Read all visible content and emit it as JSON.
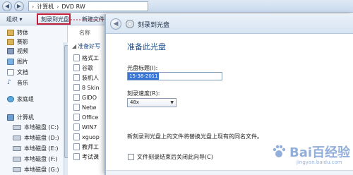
{
  "explorer": {
    "address": {
      "back_icon": "back-arrow-icon",
      "forward_icon": "forward-arrow-icon",
      "segments": [
        "计算机",
        "DVD RW"
      ]
    },
    "toolbar": {
      "organize_label": "组织 ▾",
      "burn_label": "刻录到光盘",
      "new_label": "新建文件夹"
    },
    "nav": {
      "libraries": [
        {
          "label": "视频",
          "icon": "video-library-icon"
        },
        {
          "label": "图片",
          "icon": "pictures-library-icon"
        },
        {
          "label": "文档",
          "icon": "documents-library-icon"
        },
        {
          "label": "音乐",
          "icon": "music-library-icon"
        }
      ],
      "top_items": [
        {
          "label": "转体",
          "icon": "library-icon"
        },
        {
          "label": "赛影",
          "icon": "library-icon"
        }
      ],
      "homegroup": "家庭组",
      "computer": "计算机",
      "drives": [
        "本地磁盘 (C:)",
        "本地磁盘 (D:)",
        "本地磁盘 (E:)",
        "本地磁盘 (F:)",
        "本地磁盘 (G:)"
      ]
    },
    "files": {
      "column_name": "名称",
      "group_heading": "准备好写",
      "items": [
        "格式工",
        "谷歌",
        "装机人",
        "8 Skin",
        "GIDO",
        "Netw",
        "Office",
        "WIN7",
        "xguop",
        "教师工",
        "考试课"
      ]
    }
  },
  "dialog": {
    "title": "刻录到光盘",
    "heading": "准备此光盘",
    "disc_title_label": "光盘标题(I):",
    "disc_title_value": "15-38-2011",
    "speed_label": "刻录速度(R):",
    "speed_value": "48x",
    "hint": "新刻录到光盘上的文件将替换光盘上现有的同名文件。",
    "close_wizard_label": "文件刻录结束后关闭此向导(C)",
    "close_wizard_checked": false
  },
  "watermark": {
    "text": "Bai百经验",
    "url": "jingyan.baidu.com"
  },
  "colors": {
    "highlight_border": "#c0203a",
    "heading_blue": "#1f4f8c",
    "selection_blue": "#3875d7"
  }
}
